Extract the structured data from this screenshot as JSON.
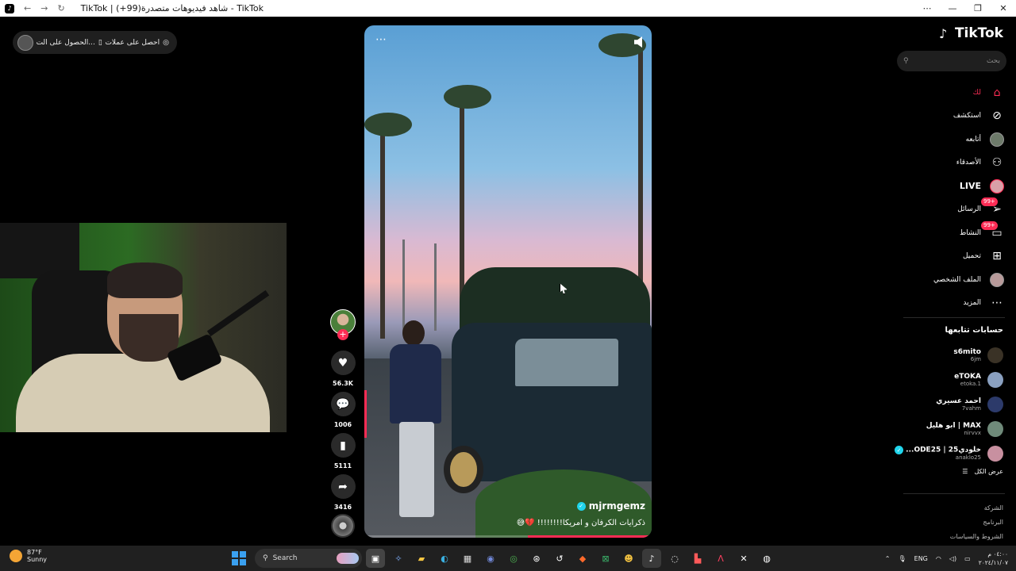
{
  "browser": {
    "tab_title": "TikTok | شاهد فيديوهات متصدرة(99+) - TikTok",
    "controls": {
      "minimize": "—",
      "restore": "❐",
      "close": "✕",
      "menu": "⋯"
    }
  },
  "top_pill": {
    "get_coins": "احصل على عملات",
    "get_app": "الحصول على الت..."
  },
  "video": {
    "author": "mjrmgemz",
    "caption": "ذكرايات الكرفان و امريكا!!!!!!!! 💔😅",
    "more_icon": "⋯",
    "progress": 0.43
  },
  "actions": {
    "likes": "56.3K",
    "comments": "1006",
    "saves": "5111",
    "shares": "3416"
  },
  "sidebar": {
    "brand": "TikTok",
    "search_placeholder": "بحث",
    "nav": [
      {
        "label": "لك",
        "icon": "home-icon"
      },
      {
        "label": "استكشف",
        "icon": "compass-icon"
      },
      {
        "label": "أتابعه",
        "icon": "avatar"
      },
      {
        "label": "الأصدقاء",
        "icon": "friends-icon"
      },
      {
        "label": "LIVE",
        "icon": "live-avatar"
      },
      {
        "label": "الرسائل",
        "icon": "send-icon",
        "badge": "99+"
      },
      {
        "label": "النشاط",
        "icon": "inbox-icon",
        "badge": "99+"
      },
      {
        "label": "تحميل",
        "icon": "upload-icon"
      },
      {
        "label": "الملف الشخصي",
        "icon": "profile-avatar"
      },
      {
        "label": "المزيد",
        "icon": "more-icon"
      }
    ],
    "following_title": "حسابات تتابعها",
    "following": [
      {
        "name": "s6mito",
        "handle": "6jm"
      },
      {
        "name": "eTOKA",
        "handle": "etoka.1"
      },
      {
        "name": "احمد عسيري",
        "handle": "7vahm"
      },
      {
        "name": "MAX | ابو هليل",
        "handle": "nirvvx"
      },
      {
        "name": "خلودي25 | ODE25...",
        "handle": "anaklo25"
      }
    ],
    "see_all": "عرض الكل",
    "footer": [
      "الشركة",
      "البرنامج",
      "الشروط والسياسات"
    ]
  },
  "taskbar": {
    "weather_temp": "87°F",
    "weather_desc": "Sunny",
    "search_label": "Search",
    "lang": "ENG",
    "time": "٠٤:٠٠ م",
    "date": "٢٠٢٤/١١/٠٧"
  },
  "colors": {
    "accent": "#fe2c55",
    "verified": "#20d5ec",
    "taskbar": "#202020"
  }
}
